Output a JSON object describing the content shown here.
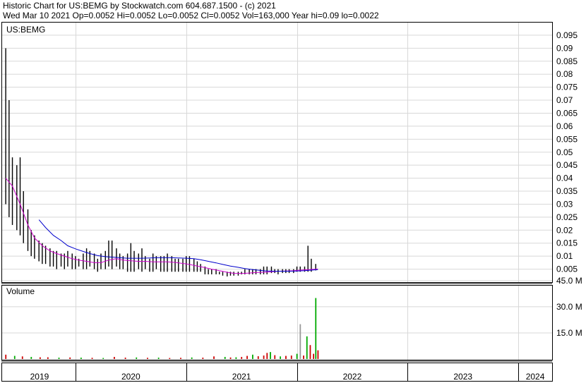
{
  "header": {
    "line1": "Historic Chart for US:BEMG by Stockwatch.com 604.687.1500 - (c) 2021",
    "line2": "Wed Mar 10 2021   Op=0.0052   Hi=0.0052   Lo=0.0052   Cl=0.0052   Vol=163,000   Year hi=0.09   lo=0.0022"
  },
  "chart_data": [
    {
      "type": "line",
      "title": "US:BEMG",
      "ylim": [
        0,
        0.1
      ],
      "ytick_labels": [
        "0.095",
        "0.09",
        "0.085",
        "0.08",
        "0.075",
        "0.07",
        "0.065",
        "0.06",
        "0.055",
        "0.05",
        "0.045",
        "0.04",
        "0.035",
        "0.03",
        "0.025",
        "0.02",
        "0.015",
        "0.01",
        "0.005"
      ],
      "x_tick_labels": [
        "2019",
        "2020",
        "2021",
        "2022",
        "2023",
        "2024"
      ],
      "series": [
        {
          "role": "price-range",
          "color": "#000000",
          "x": [
            2018.37,
            2018.4,
            2018.43,
            2018.47,
            2018.5,
            2018.53,
            2018.57,
            2018.6,
            2018.63,
            2018.67,
            2018.7,
            2018.73,
            2018.77,
            2018.8,
            2018.83,
            2018.87,
            2018.9,
            2018.93,
            2018.97,
            2019.0,
            2019.03,
            2019.07,
            2019.1,
            2019.13,
            2019.17,
            2019.2,
            2019.23,
            2019.27,
            2019.3,
            2019.33,
            2019.37,
            2019.4,
            2019.43,
            2019.47,
            2019.5,
            2019.53,
            2019.57,
            2019.6,
            2019.63,
            2019.67,
            2019.7,
            2019.73,
            2019.77,
            2019.8,
            2019.83,
            2019.87,
            2019.9,
            2019.93,
            2019.97,
            2020.0,
            2020.03,
            2020.07,
            2020.1,
            2020.13,
            2020.17,
            2020.2,
            2020.23,
            2020.27,
            2020.3,
            2020.33,
            2020.37,
            2020.4,
            2020.43,
            2020.47,
            2020.5,
            2020.53,
            2020.57,
            2020.6,
            2020.63,
            2020.67,
            2020.7,
            2020.73,
            2020.77,
            2020.8,
            2020.83,
            2020.87,
            2020.9,
            2020.93,
            2020.97,
            2021.0,
            2021.03,
            2021.07,
            2021.1,
            2021.13,
            2021.17,
            2021.19
          ],
          "high": [
            0.09,
            0.07,
            0.048,
            0.045,
            0.048,
            0.035,
            0.028,
            0.02,
            0.018,
            0.016,
            0.015,
            0.014,
            0.013,
            0.012,
            0.012,
            0.011,
            0.011,
            0.012,
            0.011,
            0.01,
            0.009,
            0.011,
            0.013,
            0.012,
            0.011,
            0.009,
            0.011,
            0.012,
            0.016,
            0.016,
            0.013,
            0.011,
            0.01,
            0.011,
            0.015,
            0.012,
            0.011,
            0.013,
            0.01,
            0.009,
            0.011,
            0.01,
            0.01,
            0.01,
            0.011,
            0.01,
            0.009,
            0.009,
            0.009,
            0.01,
            0.01,
            0.009,
            0.008,
            0.007,
            0.006,
            0.005,
            0.005,
            0.005,
            0.004,
            0.004,
            0.004,
            0.004,
            0.004,
            0.004,
            0.004,
            0.005,
            0.005,
            0.005,
            0.005,
            0.005,
            0.006,
            0.006,
            0.006,
            0.005,
            0.005,
            0.005,
            0.005,
            0.005,
            0.005,
            0.006,
            0.006,
            0.006,
            0.014,
            0.009,
            0.007,
            0.0052
          ],
          "low": [
            0.03,
            0.025,
            0.022,
            0.02,
            0.018,
            0.015,
            0.012,
            0.01,
            0.009,
            0.008,
            0.007,
            0.007,
            0.006,
            0.006,
            0.005,
            0.006,
            0.005,
            0.006,
            0.005,
            0.005,
            0.006,
            0.005,
            0.005,
            0.006,
            0.005,
            0.004,
            0.005,
            0.005,
            0.006,
            0.005,
            0.006,
            0.005,
            0.005,
            0.004,
            0.004,
            0.004,
            0.005,
            0.004,
            0.005,
            0.004,
            0.004,
            0.005,
            0.004,
            0.004,
            0.004,
            0.004,
            0.004,
            0.004,
            0.004,
            0.004,
            0.004,
            0.004,
            0.004,
            0.004,
            0.003,
            0.003,
            0.003,
            0.003,
            0.003,
            0.0025,
            0.0022,
            0.0025,
            0.0025,
            0.0025,
            0.003,
            0.003,
            0.003,
            0.003,
            0.003,
            0.003,
            0.003,
            0.003,
            0.0035,
            0.0035,
            0.003,
            0.0035,
            0.0035,
            0.0035,
            0.0035,
            0.004,
            0.004,
            0.004,
            0.004,
            0.004,
            0.0045,
            0.0052
          ]
        },
        {
          "role": "short-moving-average",
          "color": "#cc00cc",
          "x": [
            2018.37,
            2018.43,
            2018.5,
            2018.57,
            2018.63,
            2018.7,
            2018.77,
            2018.83,
            2018.9,
            2018.97,
            2019.03,
            2019.1,
            2019.17,
            2019.23,
            2019.3,
            2019.37,
            2019.43,
            2019.5,
            2019.57,
            2019.63,
            2019.7,
            2019.77,
            2019.83,
            2019.9,
            2019.97,
            2020.03,
            2020.1,
            2020.17,
            2020.23,
            2020.3,
            2020.37,
            2020.43,
            2020.5,
            2020.57,
            2020.63,
            2020.7,
            2020.77,
            2020.83,
            2020.9,
            2020.97,
            2021.03,
            2021.1,
            2021.17,
            2021.19
          ],
          "values": [
            0.04,
            0.037,
            0.03,
            0.022,
            0.017,
            0.014,
            0.012,
            0.011,
            0.01,
            0.009,
            0.0085,
            0.008,
            0.0075,
            0.0075,
            0.0085,
            0.009,
            0.0085,
            0.0082,
            0.008,
            0.008,
            0.0078,
            0.0078,
            0.0078,
            0.0076,
            0.0072,
            0.0068,
            0.0062,
            0.0056,
            0.005,
            0.0044,
            0.0038,
            0.0034,
            0.0033,
            0.0035,
            0.0037,
            0.0038,
            0.004,
            0.0042,
            0.0043,
            0.0044,
            0.0046,
            0.0048,
            0.005,
            0.0051
          ]
        },
        {
          "role": "long-moving-average",
          "color": "#0000cc",
          "x": [
            2018.67,
            2018.73,
            2018.8,
            2018.87,
            2018.93,
            2019.0,
            2019.07,
            2019.13,
            2019.2,
            2019.27,
            2019.33,
            2019.4,
            2019.47,
            2019.53,
            2019.6,
            2019.67,
            2019.73,
            2019.8,
            2019.87,
            2019.93,
            2020.0,
            2020.07,
            2020.13,
            2020.2,
            2020.27,
            2020.33,
            2020.4,
            2020.47,
            2020.53,
            2020.6,
            2020.67,
            2020.73,
            2020.8,
            2020.87,
            2020.93,
            2021.0,
            2021.07,
            2021.13,
            2021.19
          ],
          "values": [
            0.024,
            0.021,
            0.018,
            0.016,
            0.014,
            0.0128,
            0.0118,
            0.011,
            0.0102,
            0.0098,
            0.0096,
            0.0094,
            0.0092,
            0.0092,
            0.0092,
            0.0093,
            0.0094,
            0.0094,
            0.0094,
            0.0093,
            0.0092,
            0.009,
            0.0086,
            0.008,
            0.0074,
            0.0068,
            0.0062,
            0.0057,
            0.0052,
            0.0048,
            0.0045,
            0.0043,
            0.0042,
            0.0042,
            0.0042,
            0.0043,
            0.0044,
            0.0046,
            0.0048
          ]
        }
      ]
    },
    {
      "type": "bar",
      "title": "Volume",
      "ylim": [
        0,
        52
      ],
      "ytick_labels": [
        "45.0 M",
        "30.0 M",
        "15.0 M"
      ],
      "series": [
        {
          "name": "",
          "x": [
            2018.37,
            2018.45,
            2018.52,
            2018.6,
            2018.68,
            2018.75,
            2018.85,
            2018.95,
            2019.05,
            2019.15,
            2019.25,
            2019.35,
            2019.45,
            2019.55,
            2019.65,
            2019.75,
            2019.85,
            2019.95,
            2020.05,
            2020.15,
            2020.25,
            2020.35,
            2020.4,
            2020.45,
            2020.5,
            2020.55,
            2020.6,
            2020.65,
            2020.7,
            2020.73,
            2020.76,
            2020.8,
            2020.85,
            2020.9,
            2020.95,
            2021.0,
            2021.03,
            2021.06,
            2021.09,
            2021.12,
            2021.15,
            2021.17,
            2021.19
          ],
          "values": [
            2.5,
            1.8,
            1.5,
            1.2,
            1.0,
            1.0,
            0.8,
            0.9,
            0.8,
            0.7,
            0.6,
            1.2,
            0.8,
            0.9,
            0.7,
            0.8,
            0.6,
            0.7,
            0.9,
            0.8,
            1.5,
            1.2,
            0.9,
            1.0,
            1.2,
            1.8,
            2.5,
            1.6,
            2.0,
            3.5,
            4.0,
            2.2,
            1.5,
            1.8,
            2.0,
            3.0,
            20.0,
            2.0,
            13.0,
            8.0,
            3.0,
            35.0,
            5.0
          ],
          "colors": [
            "#cc0000",
            "#00aa00",
            "#cc0000",
            "#00aa00",
            "#cc0000",
            "#cc0000",
            "#00aa00",
            "#cc0000",
            "#00aa00",
            "#cc0000",
            "#00aa00",
            "#cc0000",
            "#cc0000",
            "#00aa00",
            "#cc0000",
            "#00aa00",
            "#cc0000",
            "#cc0000",
            "#00aa00",
            "#cc0000",
            "#cc0000",
            "#00aa00",
            "#cc0000",
            "#00aa00",
            "#cc0000",
            "#cc0000",
            "#00aa00",
            "#cc0000",
            "#cc0000",
            "#cc0000",
            "#00aa00",
            "#cc0000",
            "#00aa00",
            "#cc0000",
            "#cc0000",
            "#00aa00",
            "#999999",
            "#cc0000",
            "#00aa00",
            "#cc0000",
            "#cc0000",
            "#00aa00",
            "#cc0000"
          ]
        }
      ]
    }
  ]
}
